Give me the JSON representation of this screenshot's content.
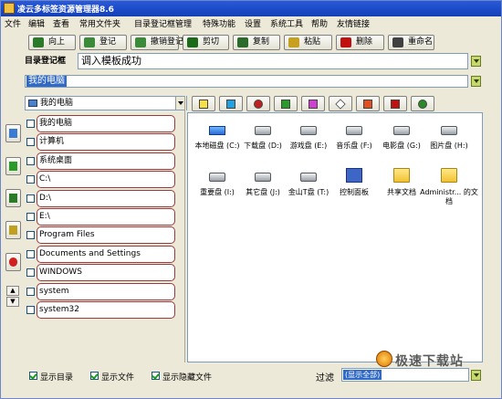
{
  "window": {
    "title": "凌云多标签资源管理器8.6"
  },
  "menu": [
    "文件",
    "编辑",
    "查看",
    "常用文件夹",
    "目录登记框管理",
    "特殊功能",
    "设置",
    "系统工具",
    "帮助",
    "友情链接"
  ],
  "toolbar": [
    {
      "label": "向上",
      "icon": "up-arrow-icon",
      "color": "#2a7a2a"
    },
    {
      "label": "登记",
      "icon": "register-icon",
      "color": "#3a8a3a"
    },
    {
      "label": "撤销登记",
      "icon": "unregister-icon",
      "color": "#3a8a3a"
    },
    {
      "label": "剪切",
      "icon": "scissors-icon",
      "color": "#1a6a1a"
    },
    {
      "label": "复制",
      "icon": "copy-icon",
      "color": "#2a6a2a"
    },
    {
      "label": "粘贴",
      "icon": "paste-icon",
      "color": "#c8a020"
    },
    {
      "label": "删除",
      "icon": "delete-icon",
      "color": "#c01010"
    },
    {
      "label": "重命名",
      "icon": "rename-icon",
      "color": "#404040"
    }
  ],
  "directory_box": {
    "label": "目录登记框",
    "value": "调入模板成功"
  },
  "path_bar": {
    "value": "我的电脑"
  },
  "combo": {
    "value": "我的电脑"
  },
  "small_tools": [
    "new-folder-icon",
    "add-icon",
    "sort-icon",
    "check-icon",
    "select-icon",
    "diamond-icon",
    "stop-icon",
    "pen-icon",
    "refresh-icon"
  ],
  "left_tools": [
    "forward-icon",
    "edit-icon",
    "tree-icon",
    "text-icon",
    "bug-icon"
  ],
  "directories": [
    "我的电脑",
    "计算机",
    "系统桌面",
    "C:\\",
    "D:\\",
    "E:\\",
    "Program Files",
    "Documents and Settings",
    "WINDOWS",
    "system",
    "system32"
  ],
  "files": [
    {
      "name": "本地磁盘 (C:)",
      "type": "sysdrive"
    },
    {
      "name": "下载盘 (D:)",
      "type": "drive"
    },
    {
      "name": "游戏盘 (E:)",
      "type": "drive"
    },
    {
      "name": "音乐盘 (F:)",
      "type": "drive"
    },
    {
      "name": "电影盘 (G:)",
      "type": "drive"
    },
    {
      "name": "图片盘 (H:)",
      "type": "drive"
    },
    {
      "name": "重要盘 (I:)",
      "type": "drive"
    },
    {
      "name": "其它盘 (J:)",
      "type": "drive"
    },
    {
      "name": "金山T盘 (T:)",
      "type": "drive"
    },
    {
      "name": "控制面板",
      "type": "ctrl"
    },
    {
      "name": "共享文档",
      "type": "folder"
    },
    {
      "name": "Administr... 的文档",
      "type": "folder"
    }
  ],
  "bottom": {
    "show_dirs": "显示目录",
    "show_files": "显示文件",
    "show_hidden": "显示隐藏文件",
    "filter_label": "过滤",
    "filter_value": "(显示全部)"
  },
  "watermark": "极速下载站"
}
